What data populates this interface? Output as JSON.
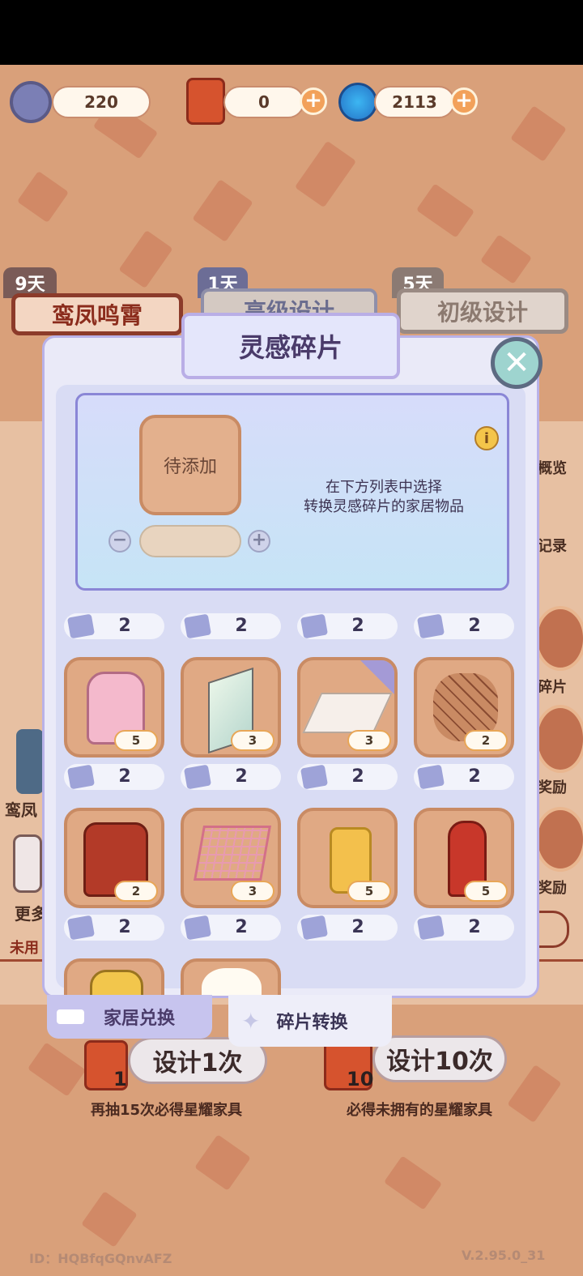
{
  "currency": {
    "shards": "220",
    "tickets": "0",
    "gems": "2113",
    "plus": "+"
  },
  "banners": [
    {
      "days": "9天",
      "label": "鸾凤鸣霄"
    },
    {
      "days": "1天",
      "label": "高级设计"
    },
    {
      "days": "5天",
      "label": "初级设计"
    }
  ],
  "side": {
    "overview": "概览",
    "records": "记录",
    "shards": "碎片",
    "reward1": "奖励",
    "reward2": "奖励",
    "left1": "鸾凤",
    "left2": "更多",
    "left3": "未用"
  },
  "modal": {
    "title": "灵感碎片",
    "close": "✕",
    "slot_label": "待添加",
    "minus": "−",
    "plus": "+",
    "info": "i",
    "hint_line1": "在下方列表中选择",
    "hint_line2": "转换灵感碎片的家居物品",
    "items": [
      {
        "cost": "2",
        "count": "5",
        "icon": "pink-backpack"
      },
      {
        "cost": "2",
        "count": "3",
        "icon": "glass-panel"
      },
      {
        "cost": "2",
        "count": "3",
        "icon": "white-steps"
      },
      {
        "cost": "2",
        "count": "2",
        "icon": "stone-path"
      },
      {
        "cost": "2",
        "count": "2",
        "icon": "red-backpack"
      },
      {
        "cost": "2",
        "count": "3",
        "icon": "shopping-cart"
      },
      {
        "cost": "2",
        "count": "5",
        "icon": "suitcase"
      },
      {
        "cost": "2",
        "count": "5",
        "icon": "fire-hydrant"
      }
    ],
    "top_row_costs": [
      "2",
      "2",
      "2",
      "2"
    ]
  },
  "tabs": {
    "exchange": "家居兑换",
    "convert": "碎片转换"
  },
  "bottom": {
    "design1": "设计1次",
    "design10": "设计10次",
    "count1": "1",
    "count10": "10",
    "note1": "再抽15次必得星耀家具",
    "note10": "必得未拥有的星耀家具"
  },
  "footer": {
    "id": "ID：HQBfqGQnvAFZ",
    "version": "V.2.95.0_31"
  }
}
